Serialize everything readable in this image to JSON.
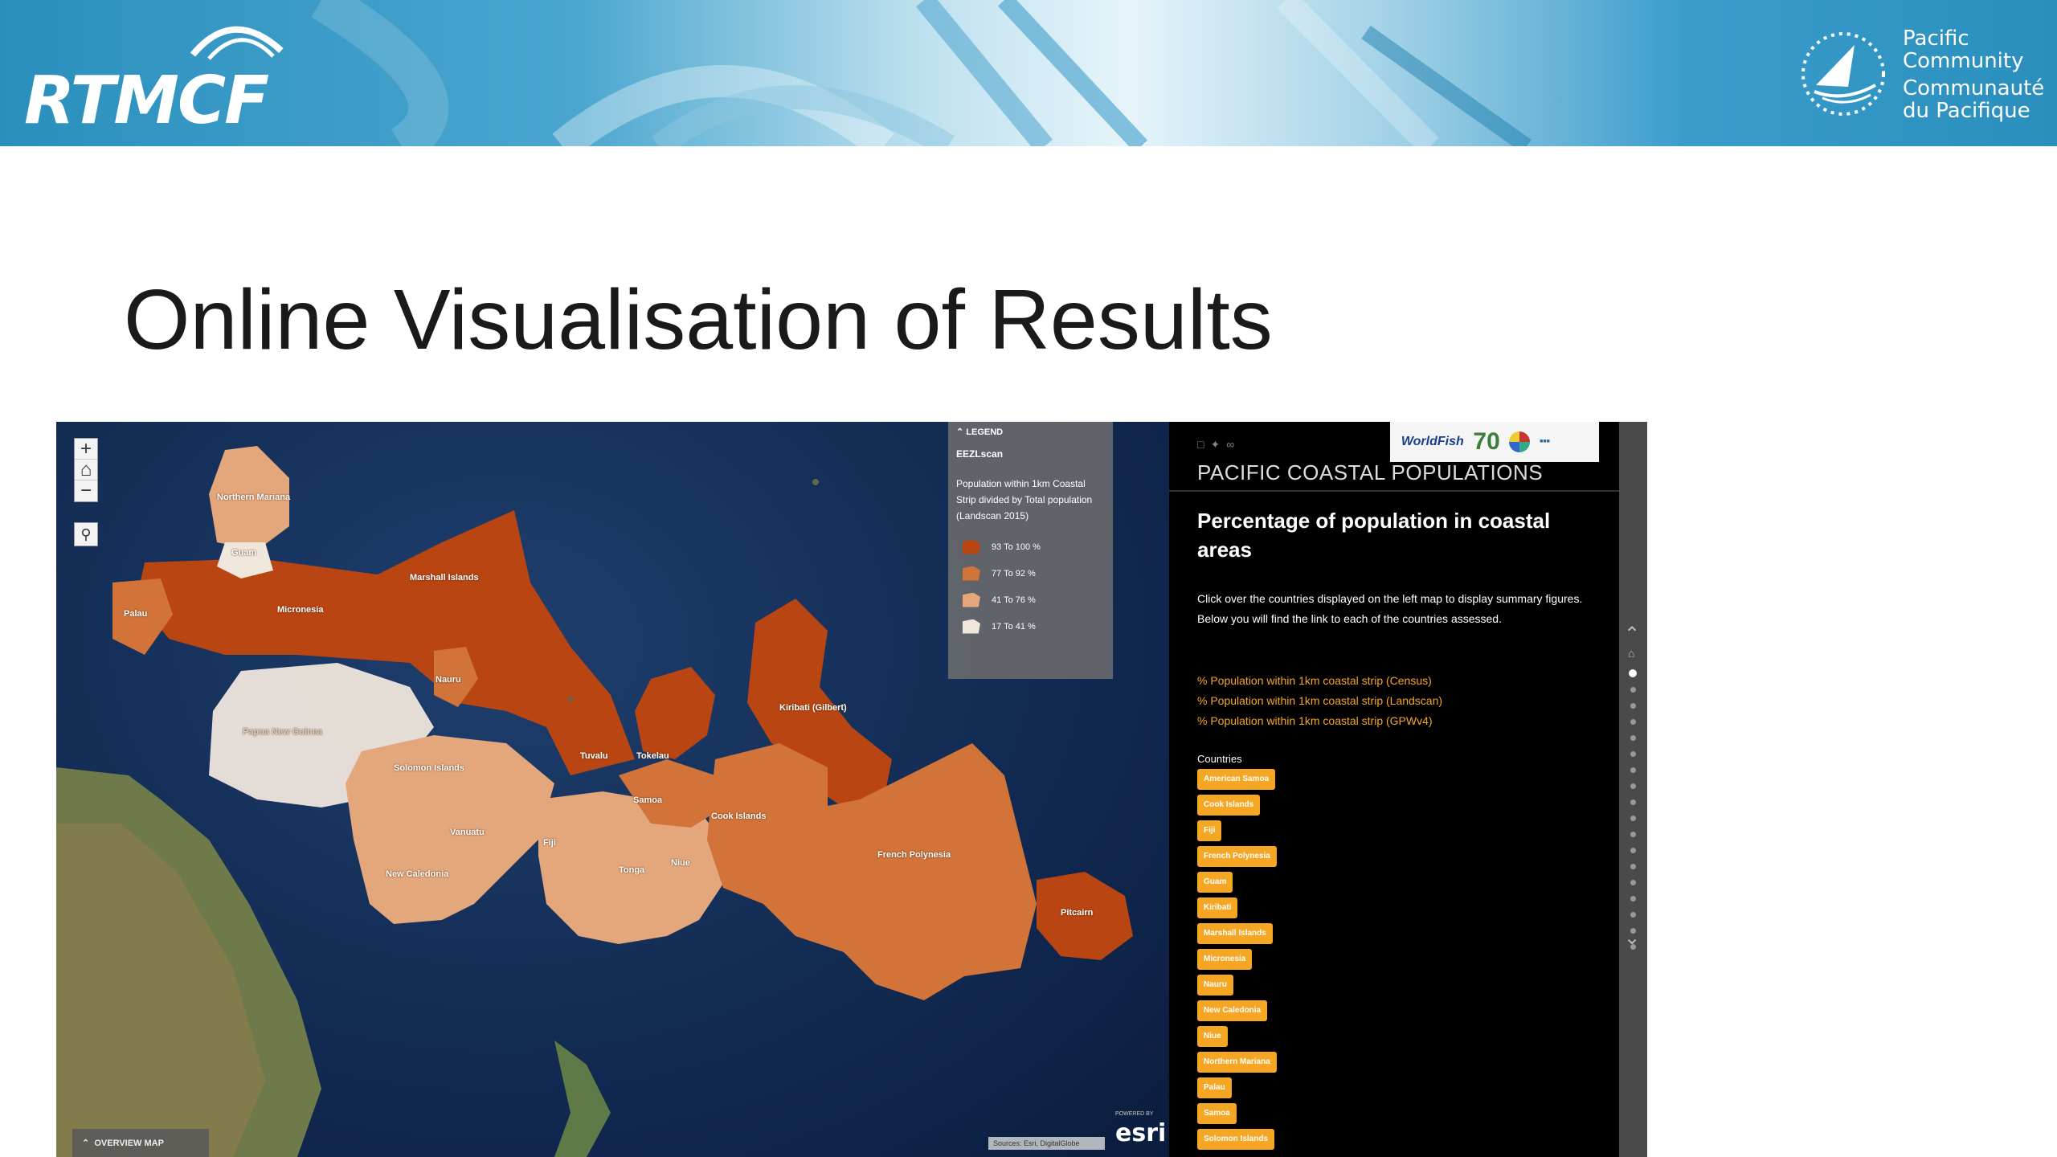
{
  "banner": {
    "left_logo_text": "RTMCF",
    "right_logo_lines": [
      "Pacific",
      "Community",
      "Communauté",
      "du Pacifique"
    ]
  },
  "slide_title": "Online Visualisation of Results",
  "map": {
    "zoom_in": "+",
    "zoom_home": "⌂",
    "zoom_out": "−",
    "search_icon": "search-icon",
    "legend": {
      "header": "LEGEND",
      "layer": "EEZLscan",
      "description": "Population within 1km Coastal Strip divided by Total population (Landscan 2015)",
      "items": [
        {
          "label": "93 To 100 %",
          "color": "#b94512"
        },
        {
          "label": "77 To 92 %",
          "color": "#d2743a"
        },
        {
          "label": "41 To 76 %",
          "color": "#e4a77c"
        },
        {
          "label": "17 To 41 %",
          "color": "#efe6dc"
        }
      ]
    },
    "countries": [
      {
        "name": "Northern Mariana"
      },
      {
        "name": "Guam"
      },
      {
        "name": "Palau"
      },
      {
        "name": "Micronesia"
      },
      {
        "name": "Marshall Islands"
      },
      {
        "name": "Nauru"
      },
      {
        "name": "Papua New Guinea"
      },
      {
        "name": "Solomon Islands"
      },
      {
        "name": "Kiribati (Gilbert)"
      },
      {
        "name": "Tuvalu"
      },
      {
        "name": "Tokelau"
      },
      {
        "name": "Samoa"
      },
      {
        "name": "Vanuatu"
      },
      {
        "name": "Fiji"
      },
      {
        "name": "Tonga"
      },
      {
        "name": "Niue"
      },
      {
        "name": "Cook Islands"
      },
      {
        "name": "New Caledonia"
      },
      {
        "name": "French Polynesia"
      },
      {
        "name": "Pitcairn"
      }
    ],
    "overview_label": "OVERVIEW MAP",
    "attribution": "Sources: Esri, DigitalGlobe",
    "esri_label": "esri",
    "esri_small": "POWERED BY"
  },
  "panel": {
    "logos": {
      "worldfish": "WorldFish",
      "seventy": "70"
    },
    "title": "PACIFIC COASTAL POPULATIONS",
    "heading": "Percentage of population in coastal areas",
    "description": [
      "Click over the countries displayed on the left map to display summary figures.",
      "Below you will find the link to each of the countries assessed."
    ],
    "links": [
      "% Population within 1km coastal strip (Census)",
      "% Population within 1km coastal strip (Landscan)",
      "% Population within 1km coastal strip (GPWv4)"
    ],
    "countries_header": "Countries",
    "country_buttons": [
      "American Samoa",
      "Cook Islands",
      "Fiji",
      "French Polynesia",
      "Guam",
      "Kiribati",
      "Marshall Islands",
      "Micronesia",
      "Nauru",
      "New Caledonia",
      "Niue",
      "Northern Mariana",
      "Palau",
      "Samoa",
      "Solomon Islands"
    ]
  }
}
